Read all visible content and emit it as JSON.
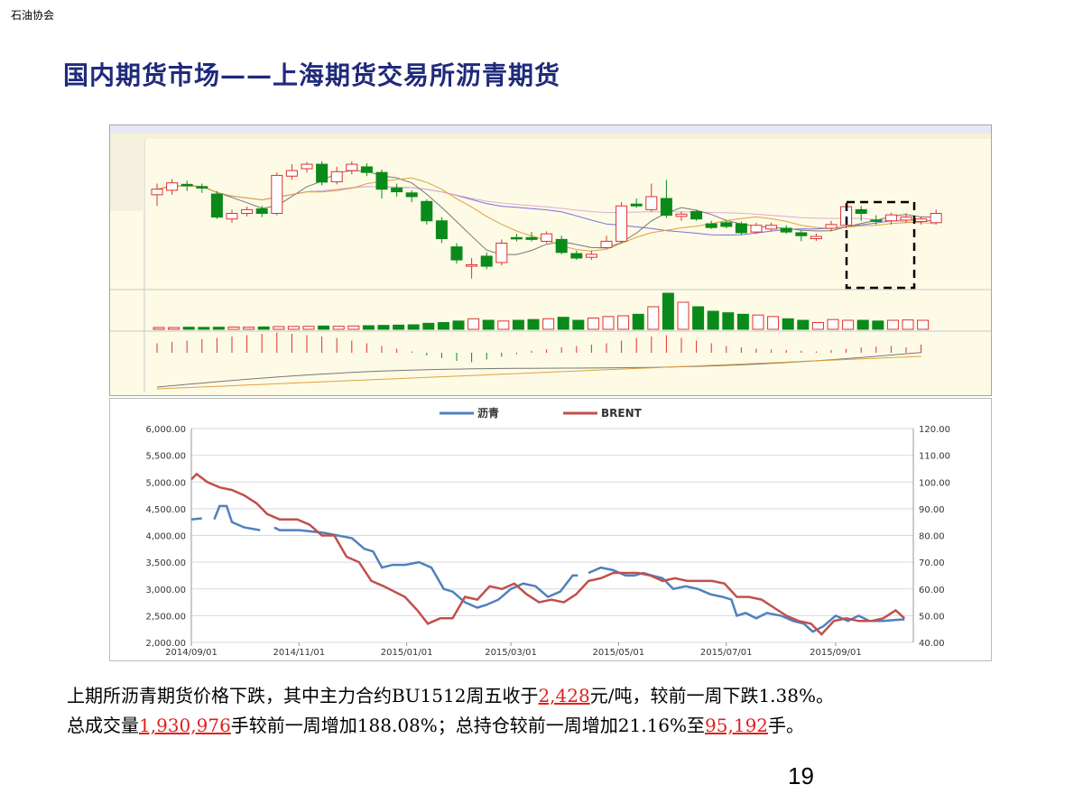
{
  "header": {
    "association": "石油协会"
  },
  "slide": {
    "title": "国内期货市场——上海期货交易所沥青期货",
    "page_number": "19"
  },
  "colors": {
    "title": "#1f2a7a",
    "asphalt_line": "#4f81bd",
    "brent_line": "#c0504d",
    "candle_up": "#e03030",
    "candle_down": "#0a8a1a",
    "highlight_value": "#e0201c"
  },
  "summary": {
    "l1_a": "上期所沥青期货价格下跌，其中主力合约BU1512周五收于",
    "l1_price": "2,428",
    "l1_b": "元/吨，较前一周下跌1.38%。",
    "l2_a": "总成交量",
    "l2_volume": "1,930,976",
    "l2_b": "手较前一周增加188.08%；总持仓较前一周增加21.16%至",
    "l2_oi": "95,192",
    "l2_c": "手。"
  },
  "chart_data": [
    {
      "type": "candlestick",
      "panel": "BU1512 daily K-line with volume and MACD",
      "title": "",
      "annotations": [
        "dashed box marking most recent trading days"
      ],
      "price_bars": [
        {
          "o": 2730,
          "c": 2745,
          "h": 2760,
          "l": 2700
        },
        {
          "o": 2742,
          "c": 2762,
          "h": 2772,
          "l": 2730
        },
        {
          "o": 2758,
          "c": 2755,
          "h": 2768,
          "l": 2740
        },
        {
          "o": 2752,
          "c": 2748,
          "h": 2760,
          "l": 2735
        },
        {
          "o": 2732,
          "c": 2670,
          "h": 2740,
          "l": 2665
        },
        {
          "o": 2665,
          "c": 2680,
          "h": 2690,
          "l": 2655
        },
        {
          "o": 2680,
          "c": 2690,
          "h": 2698,
          "l": 2672
        },
        {
          "o": 2692,
          "c": 2680,
          "h": 2700,
          "l": 2670
        },
        {
          "o": 2680,
          "c": 2782,
          "h": 2790,
          "l": 2675
        },
        {
          "o": 2780,
          "c": 2795,
          "h": 2812,
          "l": 2770
        },
        {
          "o": 2800,
          "c": 2812,
          "h": 2818,
          "l": 2790
        },
        {
          "o": 2812,
          "c": 2764,
          "h": 2820,
          "l": 2755
        },
        {
          "o": 2765,
          "c": 2792,
          "h": 2805,
          "l": 2758
        },
        {
          "o": 2795,
          "c": 2812,
          "h": 2820,
          "l": 2785
        },
        {
          "o": 2805,
          "c": 2790,
          "h": 2815,
          "l": 2780
        },
        {
          "o": 2790,
          "c": 2745,
          "h": 2798,
          "l": 2720
        },
        {
          "o": 2748,
          "c": 2738,
          "h": 2760,
          "l": 2725
        },
        {
          "o": 2735,
          "c": 2725,
          "h": 2742,
          "l": 2710
        },
        {
          "o": 2712,
          "c": 2660,
          "h": 2718,
          "l": 2650
        },
        {
          "o": 2660,
          "c": 2612,
          "h": 2670,
          "l": 2600
        },
        {
          "o": 2590,
          "c": 2555,
          "h": 2600,
          "l": 2545
        },
        {
          "o": 2538,
          "c": 2542,
          "h": 2560,
          "l": 2505
        },
        {
          "o": 2565,
          "c": 2538,
          "h": 2575,
          "l": 2530
        },
        {
          "o": 2548,
          "c": 2600,
          "h": 2610,
          "l": 2540
        },
        {
          "o": 2615,
          "c": 2612,
          "h": 2625,
          "l": 2605
        },
        {
          "o": 2615,
          "c": 2610,
          "h": 2630,
          "l": 2605
        },
        {
          "o": 2605,
          "c": 2625,
          "h": 2632,
          "l": 2600
        },
        {
          "o": 2610,
          "c": 2575,
          "h": 2620,
          "l": 2570
        },
        {
          "o": 2572,
          "c": 2560,
          "h": 2580,
          "l": 2555
        },
        {
          "o": 2562,
          "c": 2570,
          "h": 2580,
          "l": 2555
        },
        {
          "o": 2588,
          "c": 2605,
          "h": 2620,
          "l": 2585
        },
        {
          "o": 2605,
          "c": 2700,
          "h": 2710,
          "l": 2600
        },
        {
          "o": 2705,
          "c": 2700,
          "h": 2720,
          "l": 2695
        },
        {
          "o": 2690,
          "c": 2725,
          "h": 2760,
          "l": 2685
        },
        {
          "o": 2720,
          "c": 2675,
          "h": 2770,
          "l": 2668
        },
        {
          "o": 2672,
          "c": 2678,
          "h": 2685,
          "l": 2660
        },
        {
          "o": 2685,
          "c": 2665,
          "h": 2690,
          "l": 2660
        },
        {
          "o": 2652,
          "c": 2642,
          "h": 2660,
          "l": 2638
        },
        {
          "o": 2655,
          "c": 2645,
          "h": 2662,
          "l": 2640
        },
        {
          "o": 2652,
          "c": 2628,
          "h": 2658,
          "l": 2622
        },
        {
          "o": 2630,
          "c": 2648,
          "h": 2655,
          "l": 2625
        },
        {
          "o": 2638,
          "c": 2648,
          "h": 2655,
          "l": 2632
        },
        {
          "o": 2640,
          "c": 2630,
          "h": 2648,
          "l": 2625
        },
        {
          "o": 2628,
          "c": 2620,
          "h": 2634,
          "l": 2605
        },
        {
          "o": 2612,
          "c": 2618,
          "h": 2626,
          "l": 2606
        },
        {
          "o": 2640,
          "c": 2650,
          "h": 2660,
          "l": 2632
        },
        {
          "o": 2648,
          "c": 2698,
          "h": 2705,
          "l": 2640
        },
        {
          "o": 2690,
          "c": 2680,
          "h": 2700,
          "l": 2660
        },
        {
          "o": 2662,
          "c": 2660,
          "h": 2675,
          "l": 2650
        },
        {
          "o": 2660,
          "c": 2676,
          "h": 2682,
          "l": 2650
        },
        {
          "o": 2662,
          "c": 2670,
          "h": 2680,
          "l": 2655
        },
        {
          "o": 2658,
          "c": 2665,
          "h": 2672,
          "l": 2650
        },
        {
          "o": 2655,
          "c": 2680,
          "h": 2690,
          "l": 2650
        }
      ],
      "volume": [
        12,
        12,
        14,
        13,
        14,
        15,
        14,
        16,
        18,
        19,
        20,
        22,
        20,
        22,
        24,
        26,
        28,
        30,
        40,
        45,
        55,
        70,
        60,
        55,
        60,
        65,
        70,
        80,
        60,
        75,
        85,
        90,
        100,
        150,
        240,
        180,
        150,
        120,
        110,
        100,
        95,
        85,
        70,
        60,
        45,
        65,
        60,
        60,
        55,
        60,
        62,
        60
      ],
      "macd_hist": [
        14,
        16,
        18,
        20,
        22,
        24,
        26,
        28,
        30,
        28,
        26,
        24,
        22,
        18,
        14,
        10,
        6,
        2,
        -4,
        -8,
        -12,
        -14,
        -10,
        -6,
        -2,
        3,
        5,
        8,
        10,
        12,
        14,
        18,
        22,
        24,
        26,
        22,
        18,
        14,
        10,
        8,
        6,
        5,
        4,
        3,
        2,
        4,
        6,
        8,
        9,
        10,
        8,
        12
      ]
    },
    {
      "type": "line",
      "title": "",
      "xlabel": "",
      "ylabel": "",
      "x_ticks": [
        "2014/09/01",
        "2014/11/01",
        "2015/01/01",
        "2015/03/01",
        "2015/05/01",
        "2015/07/01",
        "2015/09/01"
      ],
      "y_left": {
        "min": 2000,
        "max": 6000,
        "ticks": [
          "6,000.00",
          "5,500.00",
          "5,000.00",
          "4,500.00",
          "4,000.00",
          "3,500.00",
          "3,000.00",
          "2,500.00",
          "2,000.00"
        ]
      },
      "y_right": {
        "min": 40,
        "max": 120,
        "ticks": [
          "120.00",
          "110.00",
          "100.00",
          "90.00",
          "80.00",
          "70.00",
          "60.00",
          "50.00",
          "40.00"
        ]
      },
      "legend_position": "top",
      "series": [
        {
          "name": "沥青",
          "axis": "left",
          "color": "#4f81bd",
          "points": [
            [
              "2014-09-01",
              4300
            ],
            [
              "2014-09-07",
              4320
            ],
            [
              "2014-09-09",
              null
            ],
            [
              "2014-09-14",
              4300
            ],
            [
              "2014-09-17",
              4550
            ],
            [
              "2014-09-21",
              4550
            ],
            [
              "2014-09-24",
              4250
            ],
            [
              "2014-10-01",
              4150
            ],
            [
              "2014-10-10",
              4100
            ],
            [
              "2014-10-14",
              null
            ],
            [
              "2014-10-18",
              4150
            ],
            [
              "2014-10-21",
              4100
            ],
            [
              "2014-11-01",
              4100
            ],
            [
              "2014-11-15",
              4050
            ],
            [
              "2014-12-01",
              3950
            ],
            [
              "2014-12-08",
              3750
            ],
            [
              "2014-12-13",
              3700
            ],
            [
              "2014-12-18",
              3400
            ],
            [
              "2014-12-24",
              3450
            ],
            [
              "2014-12-31",
              3450
            ],
            [
              "2015-01-08",
              3500
            ],
            [
              "2015-01-15",
              3400
            ],
            [
              "2015-01-22",
              3000
            ],
            [
              "2015-01-27",
              2950
            ],
            [
              "2015-02-03",
              2750
            ],
            [
              "2015-02-10",
              2650
            ],
            [
              "2015-02-15",
              2700
            ],
            [
              "2015-02-22",
              2800
            ],
            [
              "2015-03-01",
              3000
            ],
            [
              "2015-03-08",
              3100
            ],
            [
              "2015-03-15",
              3050
            ],
            [
              "2015-03-22",
              2850
            ],
            [
              "2015-03-29",
              2950
            ],
            [
              "2015-04-05",
              3250
            ],
            [
              "2015-04-08",
              3250
            ],
            [
              "2015-04-10",
              null
            ],
            [
              "2015-04-14",
              3300
            ],
            [
              "2015-04-21",
              3400
            ],
            [
              "2015-04-28",
              3350
            ],
            [
              "2015-05-05",
              3250
            ],
            [
              "2015-05-10",
              3250
            ],
            [
              "2015-05-15",
              3300
            ],
            [
              "2015-05-20",
              3250
            ],
            [
              "2015-05-26",
              3200
            ],
            [
              "2015-06-01",
              3000
            ],
            [
              "2015-06-08",
              3050
            ],
            [
              "2015-06-15",
              3000
            ],
            [
              "2015-06-22",
              2900
            ],
            [
              "2015-06-29",
              2850
            ],
            [
              "2015-07-04",
              2800
            ],
            [
              "2015-07-07",
              2500
            ],
            [
              "2015-07-12",
              2550
            ],
            [
              "2015-07-18",
              2450
            ],
            [
              "2015-07-24",
              2550
            ],
            [
              "2015-08-01",
              2500
            ],
            [
              "2015-08-08",
              2400
            ],
            [
              "2015-08-14",
              2350
            ],
            [
              "2015-08-19",
              2200
            ],
            [
              "2015-08-25",
              2300
            ],
            [
              "2015-09-01",
              2500
            ],
            [
              "2015-09-08",
              2400
            ],
            [
              "2015-09-14",
              2500
            ],
            [
              "2015-09-20",
              2400
            ],
            [
              "2015-09-28",
              2400
            ],
            [
              "2015-10-05",
              2420
            ],
            [
              "2015-10-10",
              2430
            ]
          ]
        },
        {
          "name": "BRENT",
          "axis": "right",
          "color": "#c0504d",
          "points": [
            [
              "2014-09-01",
              101
            ],
            [
              "2014-09-04",
              103
            ],
            [
              "2014-09-10",
              100
            ],
            [
              "2014-09-17",
              98
            ],
            [
              "2014-09-24",
              97
            ],
            [
              "2014-10-01",
              95
            ],
            [
              "2014-10-08",
              92
            ],
            [
              "2014-10-14",
              88
            ],
            [
              "2014-10-21",
              86
            ],
            [
              "2014-10-31",
              86
            ],
            [
              "2014-11-07",
              84
            ],
            [
              "2014-11-14",
              80
            ],
            [
              "2014-11-21",
              80
            ],
            [
              "2014-11-28",
              72
            ],
            [
              "2014-12-05",
              70
            ],
            [
              "2014-12-12",
              63
            ],
            [
              "2014-12-19",
              61
            ],
            [
              "2014-12-31",
              57
            ],
            [
              "2015-01-07",
              52
            ],
            [
              "2015-01-13",
              47
            ],
            [
              "2015-01-20",
              49
            ],
            [
              "2015-01-27",
              49
            ],
            [
              "2015-02-03",
              57
            ],
            [
              "2015-02-10",
              56
            ],
            [
              "2015-02-17",
              61
            ],
            [
              "2015-02-24",
              60
            ],
            [
              "2015-03-03",
              62
            ],
            [
              "2015-03-10",
              58
            ],
            [
              "2015-03-17",
              55
            ],
            [
              "2015-03-24",
              56
            ],
            [
              "2015-03-31",
              55
            ],
            [
              "2015-04-07",
              58
            ],
            [
              "2015-04-14",
              63
            ],
            [
              "2015-04-21",
              64
            ],
            [
              "2015-04-28",
              66
            ],
            [
              "2015-05-05",
              66
            ],
            [
              "2015-05-12",
              66
            ],
            [
              "2015-05-19",
              65
            ],
            [
              "2015-05-26",
              63
            ],
            [
              "2015-06-02",
              64
            ],
            [
              "2015-06-09",
              63
            ],
            [
              "2015-06-16",
              63
            ],
            [
              "2015-06-23",
              63
            ],
            [
              "2015-06-30",
              62
            ],
            [
              "2015-07-07",
              57
            ],
            [
              "2015-07-14",
              57
            ],
            [
              "2015-07-21",
              56
            ],
            [
              "2015-07-28",
              53
            ],
            [
              "2015-08-04",
              50
            ],
            [
              "2015-08-11",
              48
            ],
            [
              "2015-08-18",
              47
            ],
            [
              "2015-08-24",
              43
            ],
            [
              "2015-08-31",
              48
            ],
            [
              "2015-09-07",
              49
            ],
            [
              "2015-09-14",
              48
            ],
            [
              "2015-09-21",
              48
            ],
            [
              "2015-09-28",
              49
            ],
            [
              "2015-10-05",
              52
            ],
            [
              "2015-10-10",
              49
            ]
          ]
        }
      ]
    }
  ]
}
